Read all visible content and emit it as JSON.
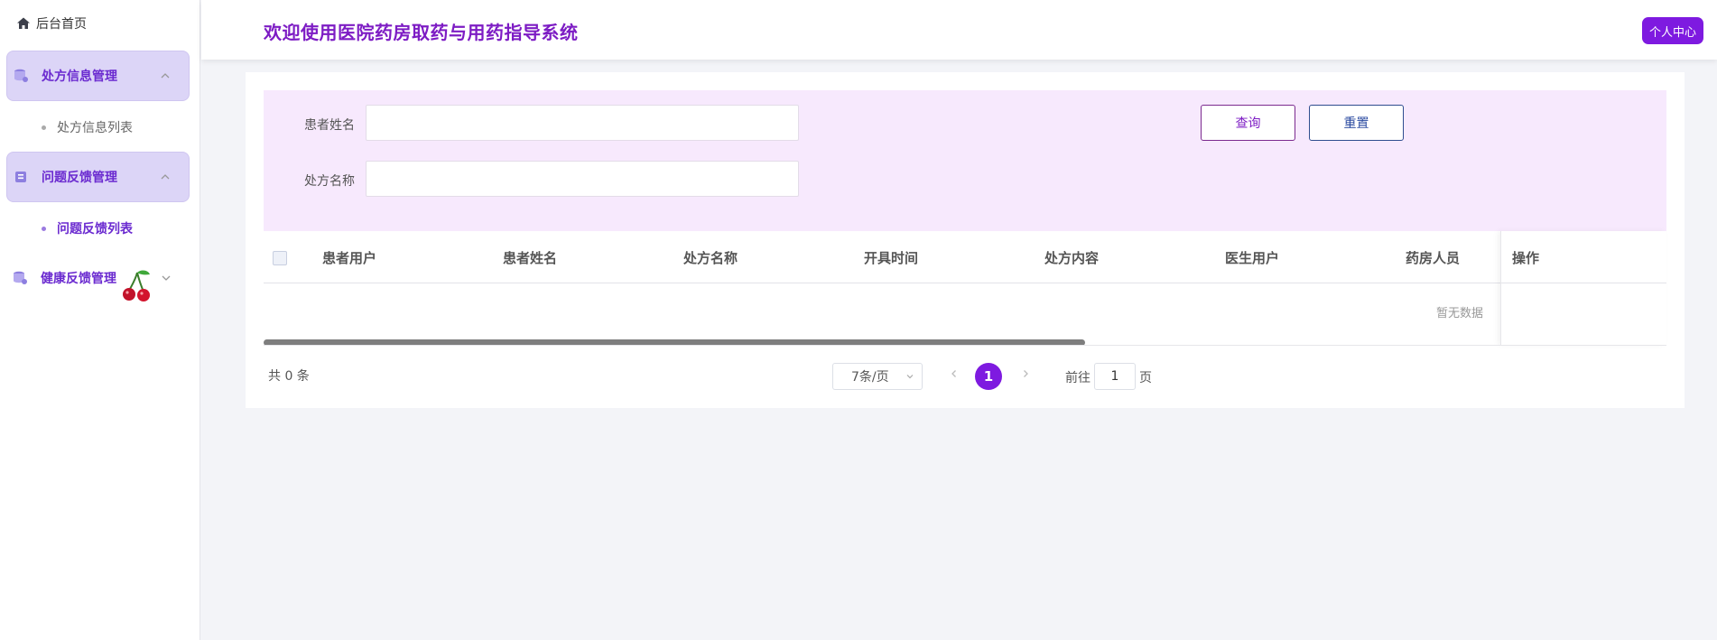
{
  "sidebar": {
    "home_label": "后台首页",
    "groups": [
      {
        "label": "处方信息管理",
        "sub": "处方信息列表"
      },
      {
        "label": "问题反馈管理",
        "sub": "问题反馈列表"
      },
      {
        "label": "健康反馈管理"
      }
    ]
  },
  "header": {
    "title": "欢迎使用医院药房取药与用药指导系统",
    "user_button": "个人中心"
  },
  "search": {
    "patient_name_label": "患者姓名",
    "patient_name_value": "",
    "prescription_name_label": "处方名称",
    "prescription_name_value": "",
    "query_button": "查询",
    "reset_button": "重置"
  },
  "table": {
    "columns": [
      "患者用户",
      "患者姓名",
      "处方名称",
      "开具时间",
      "处方内容",
      "医生用户",
      "药房人员",
      "操作"
    ],
    "empty_text": "暂无数据"
  },
  "pagination": {
    "total": "共 0 条",
    "page_size": "7条/页",
    "current_page": "1",
    "goto_label": "前往",
    "goto_value": "1",
    "page_suffix": "页"
  },
  "colors": {
    "accent": "#7e1ae0",
    "title": "#7d1cc4",
    "menu_active_bg": "#dcd5f7",
    "search_bg": "#f7e9fd"
  }
}
